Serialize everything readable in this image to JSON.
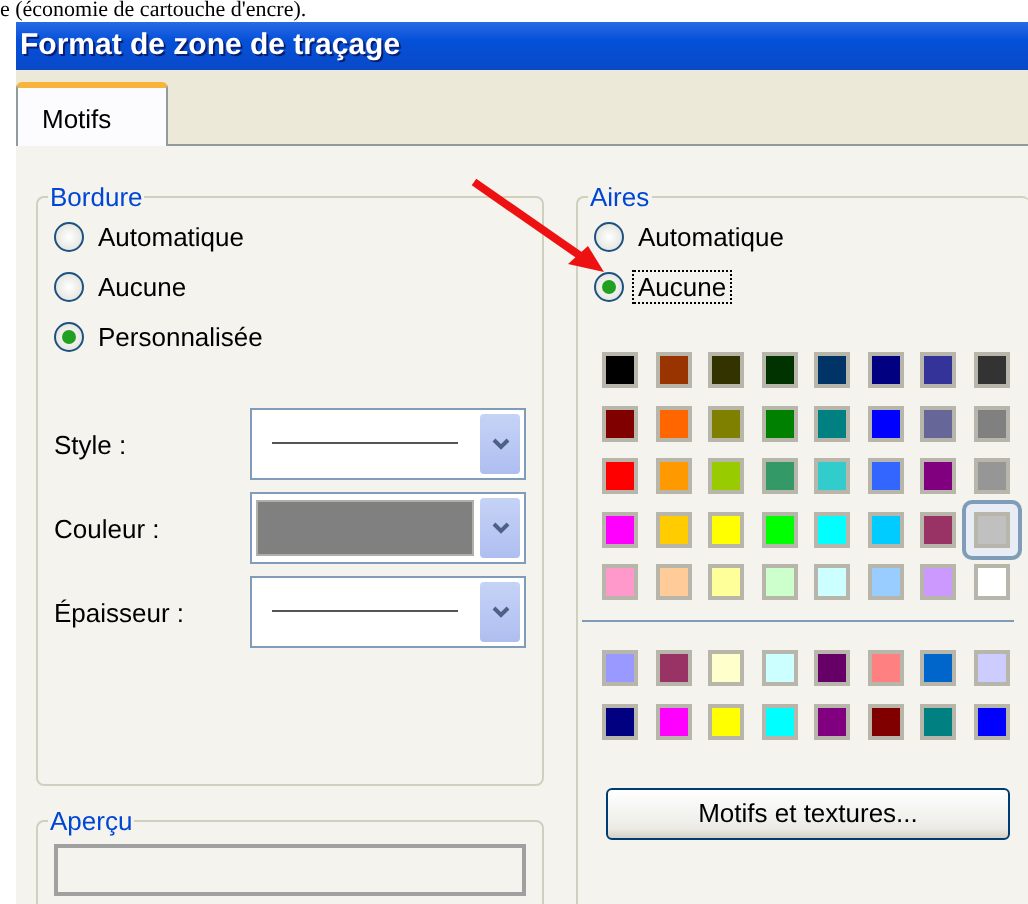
{
  "caption": "e (économie de cartouche d'encre).",
  "window": {
    "title": "Format de zone de traçage"
  },
  "tabs": [
    {
      "label": "Motifs",
      "selected": true
    }
  ],
  "border": {
    "legend": "Bordure",
    "options": [
      {
        "label": "Automatique",
        "selected": false
      },
      {
        "label": "Aucune",
        "selected": false
      },
      {
        "label": "Personnalisée",
        "selected": true
      }
    ],
    "fields": [
      {
        "label": "Style :",
        "kind": "line"
      },
      {
        "label": "Couleur :",
        "kind": "color",
        "color": "#808080"
      },
      {
        "label": "Épaisseur :",
        "kind": "line"
      }
    ]
  },
  "preview": {
    "legend": "Aperçu"
  },
  "area": {
    "legend": "Aires",
    "options": [
      {
        "label": "Automatique",
        "selected": false,
        "focused": false
      },
      {
        "label": "Aucune",
        "selected": true,
        "focused": true
      }
    ],
    "palette": [
      {
        "color": "#000000",
        "selected": false
      },
      {
        "color": "#993300",
        "selected": false
      },
      {
        "color": "#333300",
        "selected": false
      },
      {
        "color": "#003300",
        "selected": false
      },
      {
        "color": "#003366",
        "selected": false
      },
      {
        "color": "#000080",
        "selected": false
      },
      {
        "color": "#333399",
        "selected": false
      },
      {
        "color": "#333333",
        "selected": false
      },
      {
        "color": "#800000",
        "selected": false
      },
      {
        "color": "#ff6600",
        "selected": false
      },
      {
        "color": "#808000",
        "selected": false
      },
      {
        "color": "#008000",
        "selected": false
      },
      {
        "color": "#008080",
        "selected": false
      },
      {
        "color": "#0000ff",
        "selected": false
      },
      {
        "color": "#666699",
        "selected": false
      },
      {
        "color": "#808080",
        "selected": false
      },
      {
        "color": "#ff0000",
        "selected": false
      },
      {
        "color": "#ff9900",
        "selected": false
      },
      {
        "color": "#99cc00",
        "selected": false
      },
      {
        "color": "#339966",
        "selected": false
      },
      {
        "color": "#33cccc",
        "selected": false
      },
      {
        "color": "#3366ff",
        "selected": false
      },
      {
        "color": "#800080",
        "selected": false
      },
      {
        "color": "#969696",
        "selected": false
      },
      {
        "color": "#ff00ff",
        "selected": false
      },
      {
        "color": "#ffcc00",
        "selected": false
      },
      {
        "color": "#ffff00",
        "selected": false
      },
      {
        "color": "#00ff00",
        "selected": false
      },
      {
        "color": "#00ffff",
        "selected": false
      },
      {
        "color": "#00ccff",
        "selected": false
      },
      {
        "color": "#993366",
        "selected": false
      },
      {
        "color": "#c0c0c0",
        "selected": true
      },
      {
        "color": "#ff99cc",
        "selected": false
      },
      {
        "color": "#ffcc99",
        "selected": false
      },
      {
        "color": "#ffff99",
        "selected": false
      },
      {
        "color": "#ccffcc",
        "selected": false
      },
      {
        "color": "#ccffff",
        "selected": false
      },
      {
        "color": "#99ccff",
        "selected": false
      },
      {
        "color": "#cc99ff",
        "selected": false
      },
      {
        "color": "#ffffff",
        "selected": false
      }
    ],
    "chart_colors": [
      {
        "color": "#9999ff"
      },
      {
        "color": "#993366"
      },
      {
        "color": "#ffffcc"
      },
      {
        "color": "#ccffff"
      },
      {
        "color": "#660066"
      },
      {
        "color": "#ff8080"
      },
      {
        "color": "#0066cc"
      },
      {
        "color": "#ccccff"
      },
      {
        "color": "#000080"
      },
      {
        "color": "#ff00ff"
      },
      {
        "color": "#ffff00"
      },
      {
        "color": "#00ffff"
      },
      {
        "color": "#800080"
      },
      {
        "color": "#800000"
      },
      {
        "color": "#008080"
      },
      {
        "color": "#0000ff"
      }
    ],
    "button": "Motifs et textures..."
  }
}
